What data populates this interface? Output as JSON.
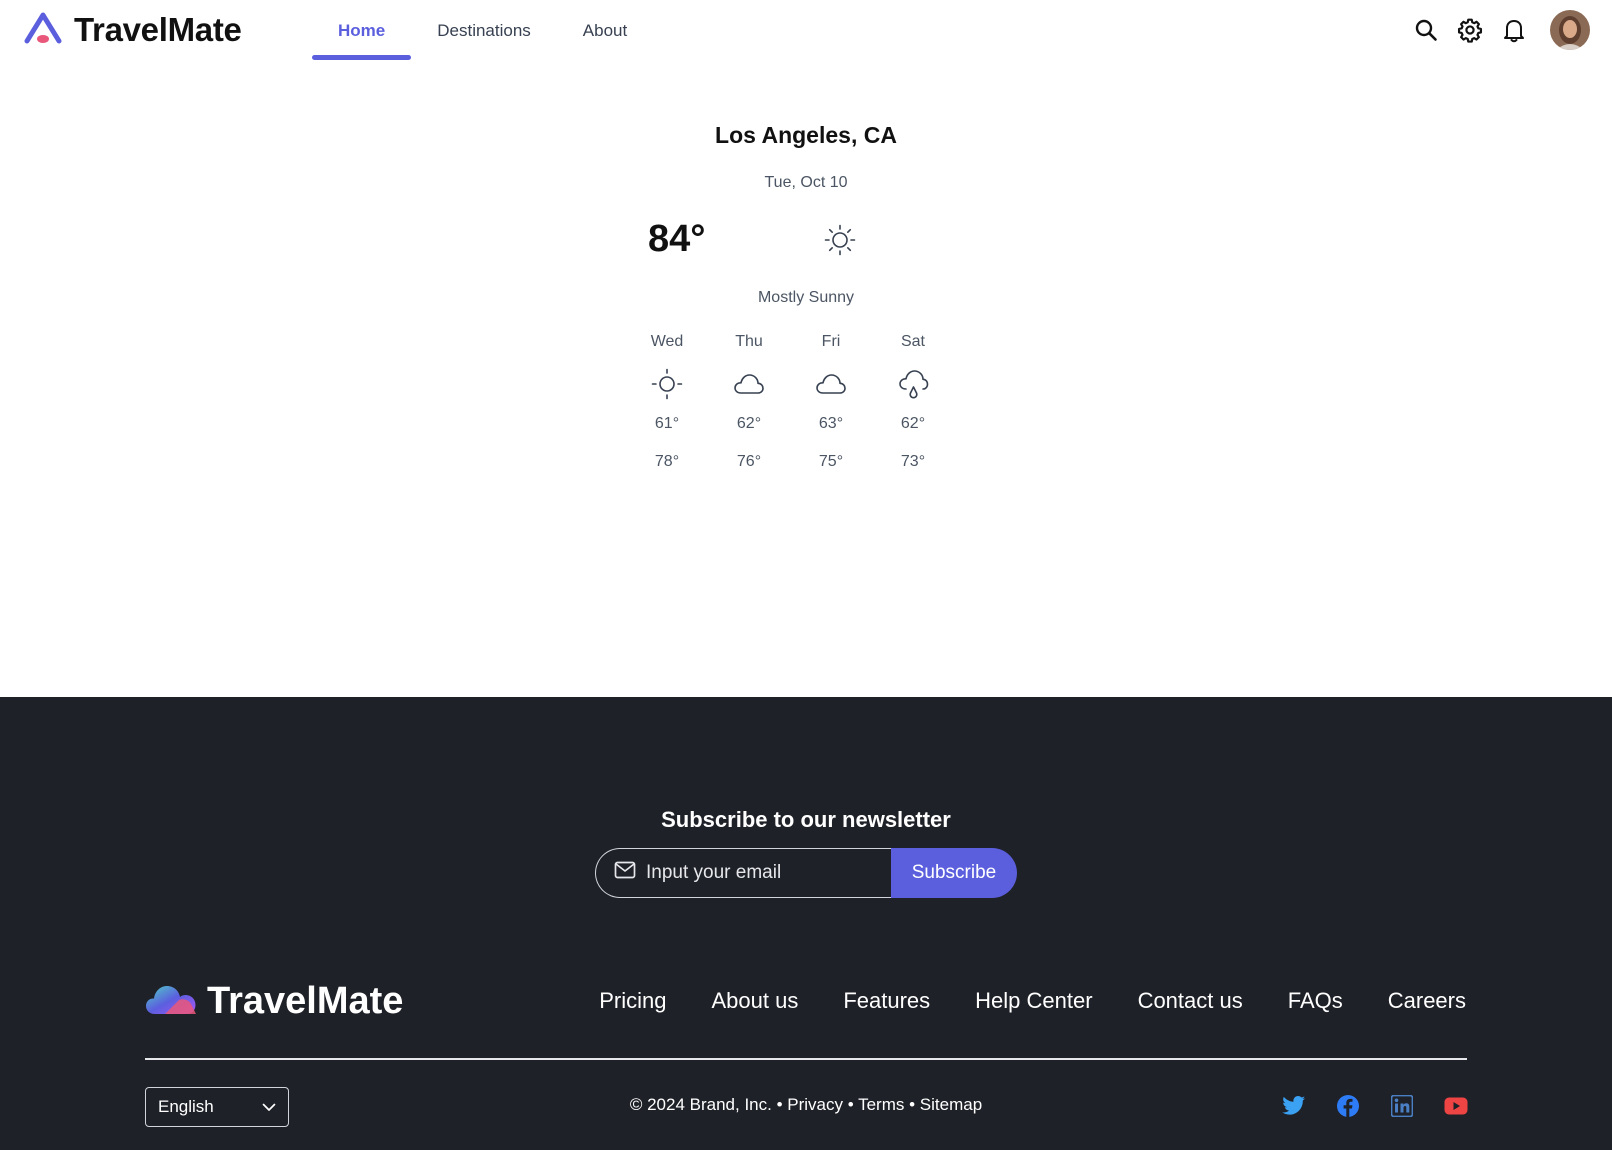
{
  "header": {
    "brand_name": "TravelMate",
    "nav": [
      {
        "label": "Home",
        "active": true
      },
      {
        "label": "Destinations",
        "active": false
      },
      {
        "label": "About",
        "active": false
      }
    ],
    "actions": [
      "search-icon",
      "gear-icon",
      "bell-icon",
      "avatar"
    ],
    "accent_color": "#5b5fde"
  },
  "weather": {
    "city": "Los Angeles, CA",
    "date": "Tue, Oct 10",
    "temperature": "84°",
    "condition": "Mostly Sunny",
    "current_icon": "sun-icon",
    "forecast": [
      {
        "day": "Wed",
        "icon": "sun-icon",
        "low": "61°",
        "high": "78°"
      },
      {
        "day": "Thu",
        "icon": "cloud-icon",
        "low": "62°",
        "high": "76°"
      },
      {
        "day": "Fri",
        "icon": "cloud-icon",
        "low": "63°",
        "high": "75°"
      },
      {
        "day": "Sat",
        "icon": "rain-icon",
        "low": "62°",
        "high": "73°"
      }
    ]
  },
  "footer": {
    "newsletter_title": "Subscribe to our newsletter",
    "email_placeholder": "Input your email",
    "subscribe_label": "Subscribe",
    "brand_name": "TravelMate",
    "links": [
      "Pricing",
      "About us",
      "Features",
      "Help Center",
      "Contact us",
      "FAQs",
      "Careers"
    ],
    "language": "English",
    "copyright": "© 2024 Brand, Inc.",
    "legal_links": [
      "Privacy",
      "Terms",
      "Sitemap"
    ],
    "socials": [
      "twitter-icon",
      "facebook-icon",
      "linkedin-icon",
      "youtube-icon"
    ],
    "background_color": "#1f2128"
  }
}
